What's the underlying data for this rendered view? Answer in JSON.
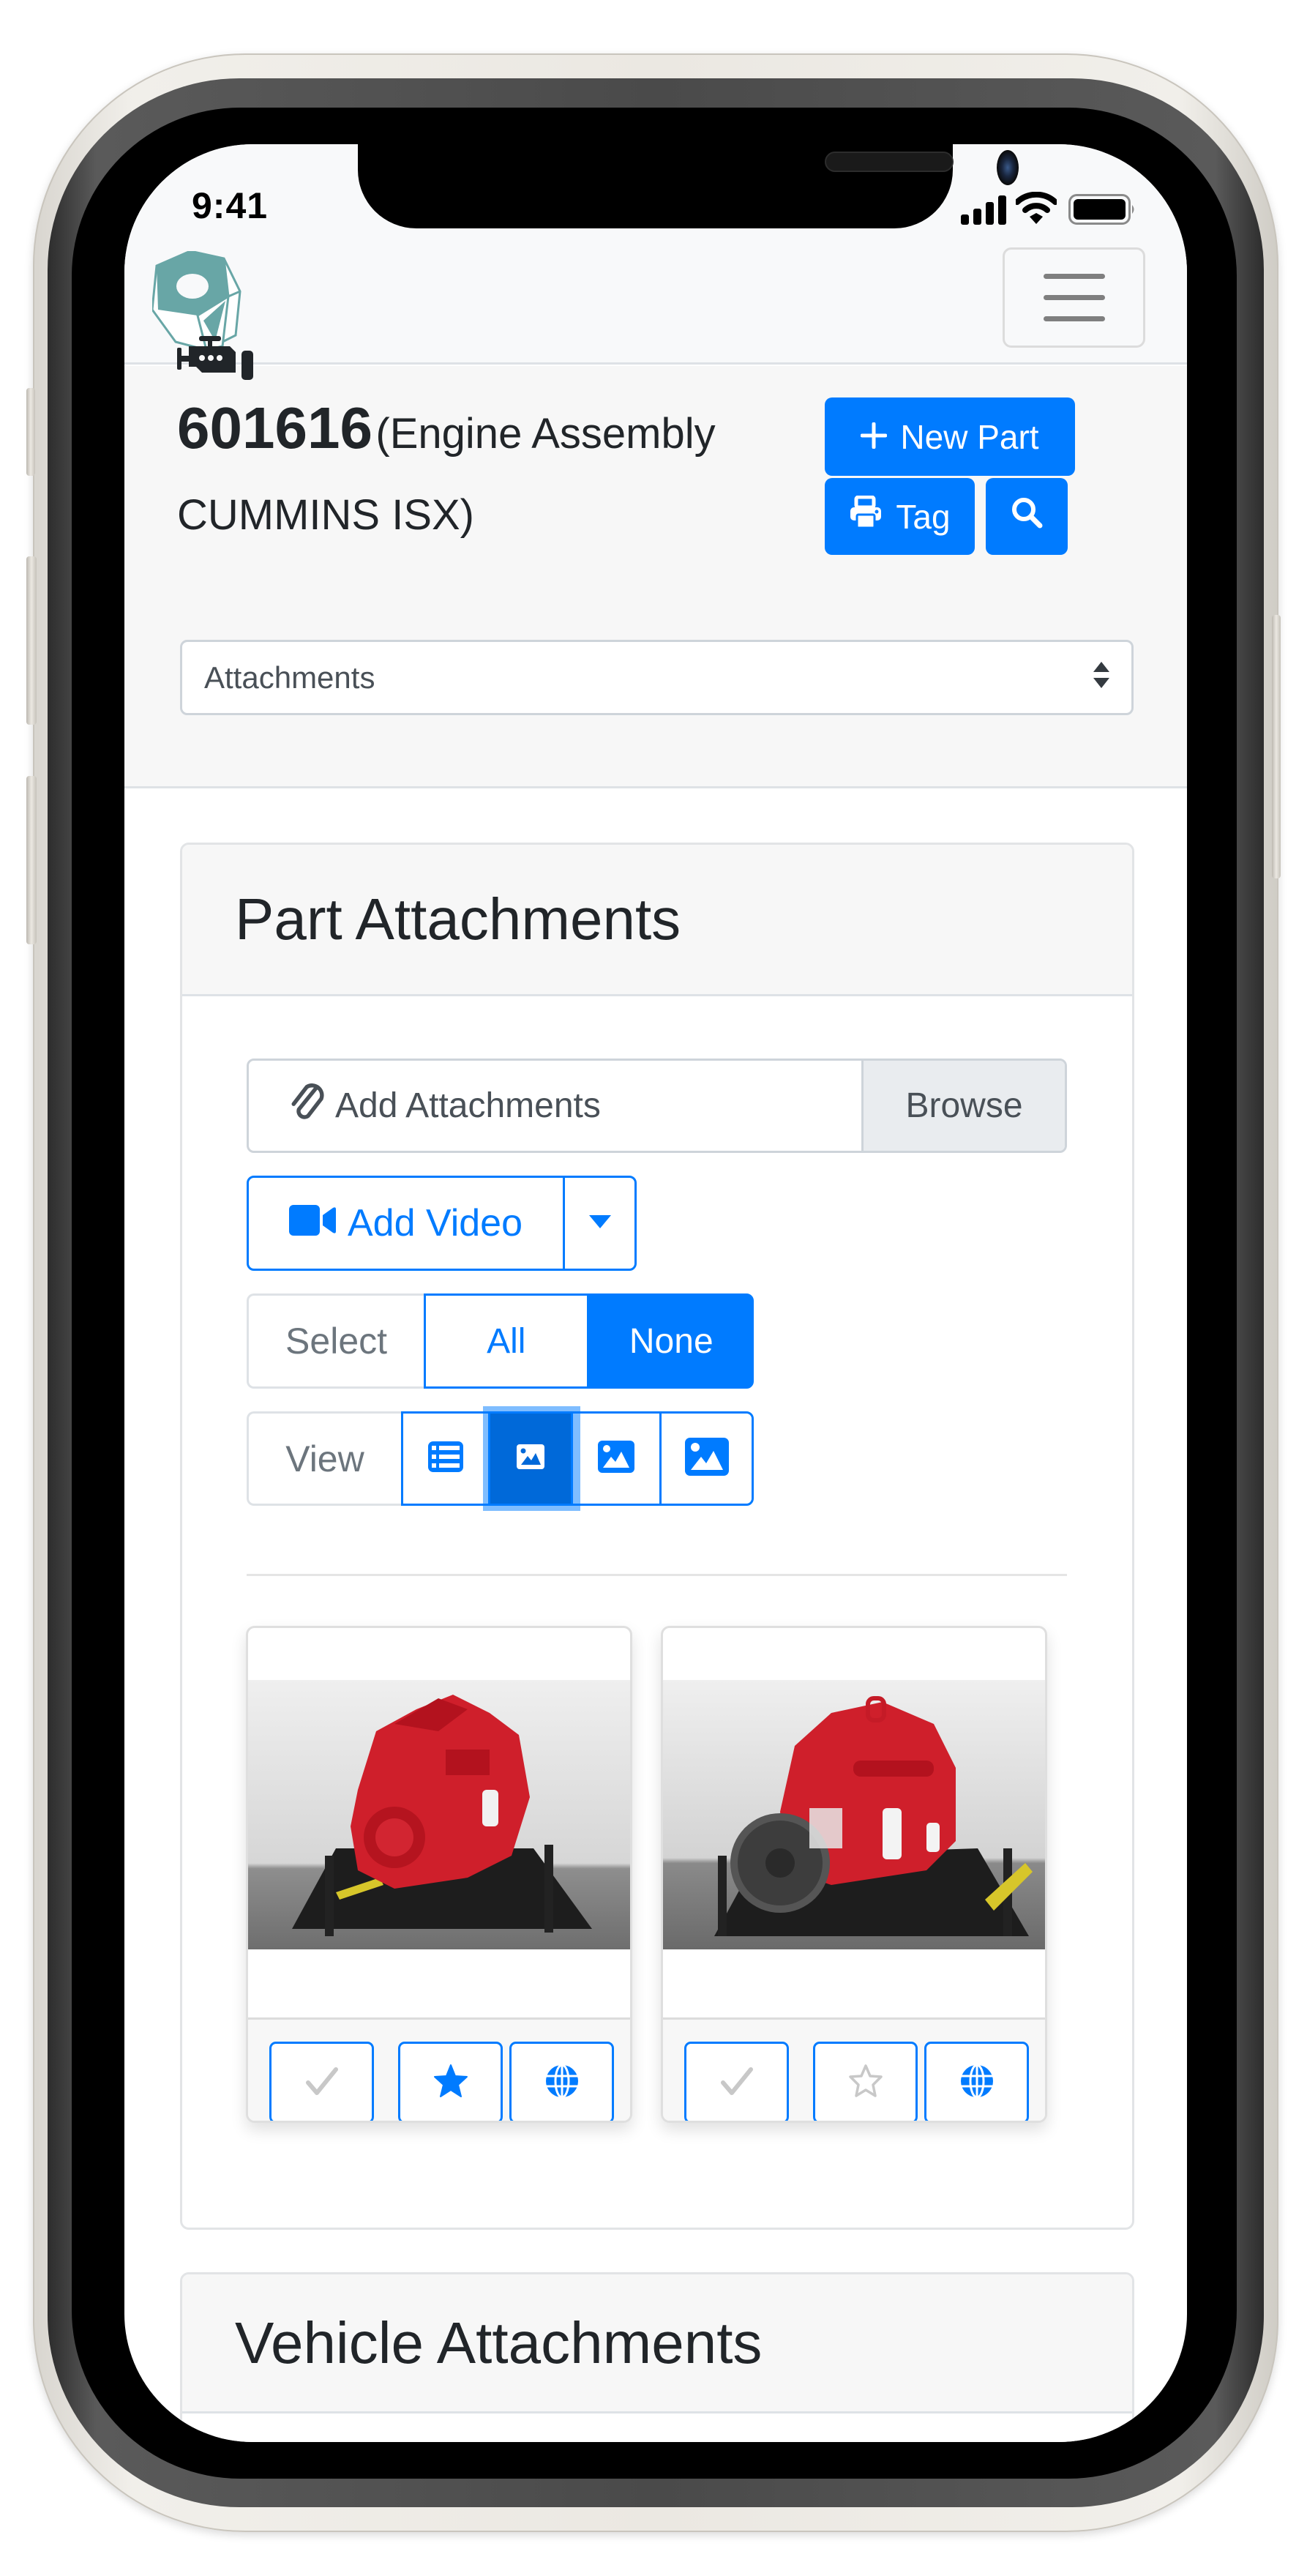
{
  "status_bar": {
    "time": "9:41",
    "icons": [
      "signal-icon",
      "wifi-icon",
      "battery-icon"
    ]
  },
  "navbar": {
    "logo": "hex-nut-logo",
    "menu_icon": "hamburger-menu-icon"
  },
  "part": {
    "type_icon": "engine-icon",
    "number": "601616",
    "description": "(Engine Assembly CUMMINS ISX)",
    "actions": {
      "new_part_label": "New Part",
      "new_part_icon": "plus-icon",
      "tag_label": "Tag",
      "tag_icon": "printer-icon",
      "search_icon": "search-icon"
    },
    "section_select": {
      "selected": "Attachments"
    }
  },
  "part_attachments": {
    "title": "Part Attachments",
    "file_input": {
      "placeholder": "Add Attachments",
      "icon": "paperclip-icon",
      "browse_label": "Browse"
    },
    "add_video": {
      "label": "Add Video",
      "icon": "video-camera-icon",
      "dropdown_icon": "caret-down-icon"
    },
    "select": {
      "label": "Select",
      "options": [
        {
          "label": "All",
          "active": false
        },
        {
          "label": "None",
          "active": true
        }
      ]
    },
    "view": {
      "label": "View",
      "options": [
        {
          "name": "list-view",
          "icon": "list-icon",
          "active": false
        },
        {
          "name": "small-thumbnails",
          "icon": "image-icon-small",
          "active": true
        },
        {
          "name": "medium-thumbnails",
          "icon": "image-icon-medium",
          "active": false
        },
        {
          "name": "large-thumbnails",
          "icon": "image-icon-large",
          "active": false
        }
      ]
    },
    "items": [
      {
        "image": "red-engine-photo-front",
        "selected": false,
        "favorite": true,
        "public": true
      },
      {
        "image": "red-engine-photo-flywheel",
        "selected": false,
        "favorite": false,
        "public": true
      }
    ]
  },
  "vehicle_attachments": {
    "title": "Vehicle Attachments"
  },
  "colors": {
    "primary": "#007bff",
    "primary_active": "#0069d9",
    "logo_teal": "#68a6a6",
    "text_dark": "#212529",
    "muted": "#6c757d",
    "inactive_icon": "#c8c8c8"
  }
}
